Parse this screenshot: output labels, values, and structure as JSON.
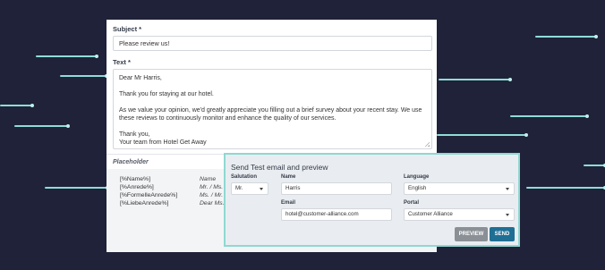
{
  "email": {
    "subject_label": "Subject *",
    "subject_value": "Please review us!",
    "text_label": "Text *",
    "text_paragraphs": [
      "Dear Mr Harris,",
      "Thank you for staying at our hotel.",
      "As we value your opinion, we'd greatly appreciate you filling out a brief survey about your recent stay. We use these reviews to continuously monitor and enhance the quality of our services.",
      "Thank you,\nYour team from Hotel Get Away"
    ]
  },
  "placeholder": {
    "title": "Placeholder",
    "rows": [
      {
        "key": "[%Name%]",
        "value": "Name"
      },
      {
        "key": "[%Anrede%]",
        "value": "Mr. / Ms. /"
      },
      {
        "key": "[%FormelleAnrede%]",
        "value": "Ms. / Mr. /"
      },
      {
        "key": "[%LiebeAnrede%]",
        "value": "Dear Ms. /"
      }
    ]
  },
  "test_email": {
    "title": "Send Test email and preview",
    "salutation_label": "Salutation",
    "salutation_value": "Mr.",
    "name_label": "Name",
    "name_value": "Harris",
    "language_label": "Language",
    "language_value": "English",
    "email_label": "Email",
    "email_value": "hotel@customer-alliance.com",
    "portal_label": "Portal",
    "portal_value": "Customer Alliance",
    "preview_label": "PREVIEW",
    "send_label": "SEND"
  },
  "colors": {
    "background": "#1f2238",
    "accent": "#8fdcd8",
    "send_button": "#1f6f95",
    "preview_button": "#8a9096"
  }
}
